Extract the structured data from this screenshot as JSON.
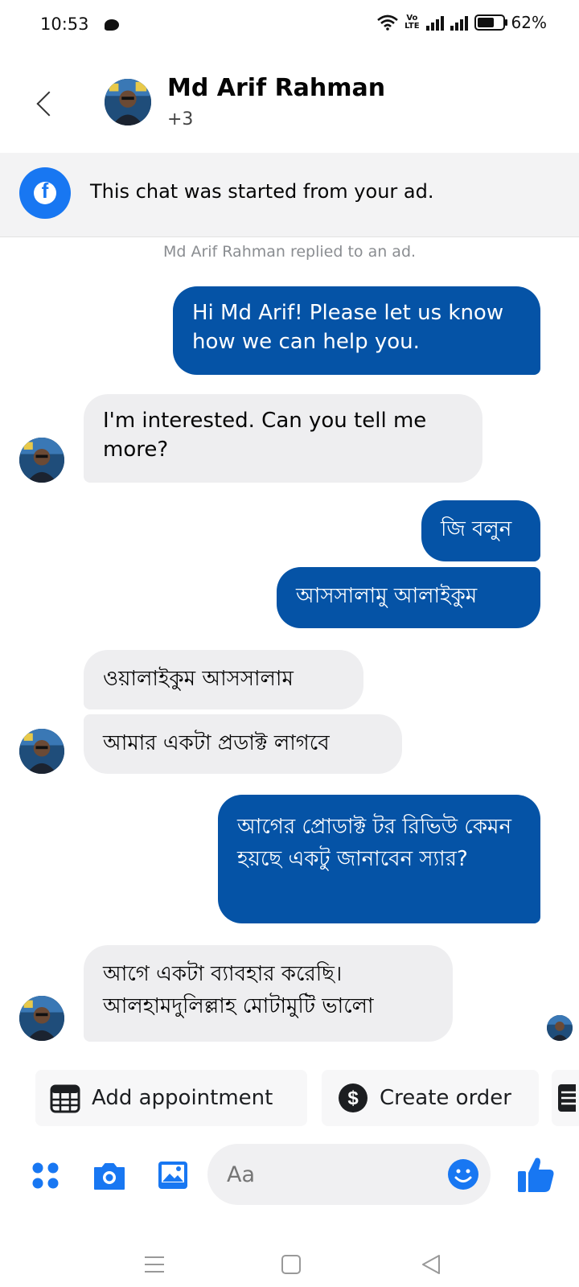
{
  "status_bar": {
    "time": "10:53",
    "battery": "62%",
    "volte_top": "Vo",
    "volte_bottom": "LTE"
  },
  "header": {
    "contact_name": "Md Arif Rahman",
    "subtitle": "+3",
    "back_icon": "chevron-left-icon"
  },
  "ad_banner": {
    "text": "This chat was started from your ad.",
    "icon": "facebook-icon"
  },
  "meta_line": "Md Arif Rahman replied to an ad.",
  "messages": [
    {
      "from": "me",
      "text": "Hi Md Arif! Please let us know how we can help you."
    },
    {
      "from": "them",
      "text": "I'm interested. Can you tell me more?"
    },
    {
      "from": "me",
      "text": "জি বলুন"
    },
    {
      "from": "me",
      "text": "আসসালামু আলাইকুম"
    },
    {
      "from": "them",
      "text": "ওয়ালাইকুম আসসালাম"
    },
    {
      "from": "them",
      "text": "আমার একটা প্রডাক্ট লাগবে"
    },
    {
      "from": "me",
      "text": "আগের প্রোডাক্ট টর রিভিউ কেমন হয়ছে একটু জানাবেন স্যার?"
    },
    {
      "from": "them",
      "text": "আগে একটা ব্যাবহার করেছি। আলহামদুলিল্লাহ মোটামুটি ভালো"
    }
  ],
  "quick_actions": [
    {
      "label": "Add appointment",
      "icon": "calendar-icon"
    },
    {
      "label": "Create order",
      "icon": "dollar-icon"
    }
  ],
  "composer": {
    "placeholder": "Aa"
  },
  "colors": {
    "outgoing_bubble": "#0553a6",
    "incoming_bubble": "#eeeef0",
    "accent": "#1877f2"
  }
}
